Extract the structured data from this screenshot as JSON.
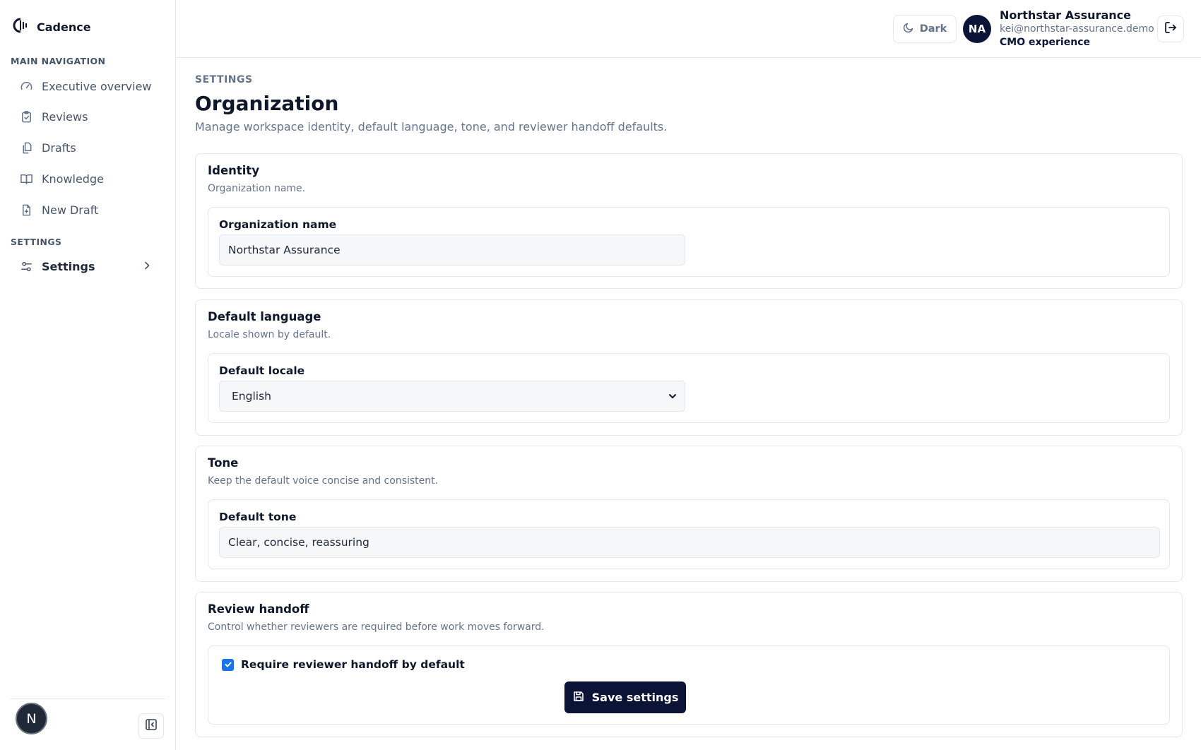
{
  "app": {
    "name": "Cadence"
  },
  "sidebar": {
    "main_label": "MAIN NAVIGATION",
    "items": [
      {
        "label": "Executive overview",
        "icon": "gauge-icon"
      },
      {
        "label": "Reviews",
        "icon": "clipboard-check-icon"
      },
      {
        "label": "Drafts",
        "icon": "copy-document-icon"
      },
      {
        "label": "Knowledge",
        "icon": "book-open-icon"
      },
      {
        "label": "New Draft",
        "icon": "file-plus-icon"
      }
    ],
    "settings_label": "SETTINGS",
    "settings_item": {
      "label": "Settings",
      "icon": "sliders-icon"
    },
    "footer_badge": "N"
  },
  "header": {
    "theme_toggle": "Dark",
    "avatar_initials": "NA",
    "user_name": "Northstar Assurance",
    "user_email": "kei@northstar-assurance.demo",
    "user_role": "CMO experience"
  },
  "page": {
    "eyebrow": "SETTINGS",
    "title": "Organization",
    "description": "Manage workspace identity, default language, tone, and reviewer handoff defaults."
  },
  "identity": {
    "title": "Identity",
    "subtitle": "Organization name.",
    "field_label": "Organization name",
    "value": "Northstar Assurance"
  },
  "language": {
    "title": "Default language",
    "subtitle": "Locale shown by default.",
    "field_label": "Default locale",
    "value": "English"
  },
  "tone": {
    "title": "Tone",
    "subtitle": "Keep the default voice concise and consistent.",
    "field_label": "Default tone",
    "value": "Clear, concise, reassuring"
  },
  "handoff": {
    "title": "Review handoff",
    "subtitle": "Control whether reviewers are required before work moves forward.",
    "checkbox_label": "Require reviewer handoff by default",
    "checked": true,
    "save_label": "Save settings"
  },
  "colors": {
    "primary": "#0b1437",
    "checkbox": "#1a73e8",
    "muted_text": "#64748b",
    "border": "#e5e7eb"
  }
}
